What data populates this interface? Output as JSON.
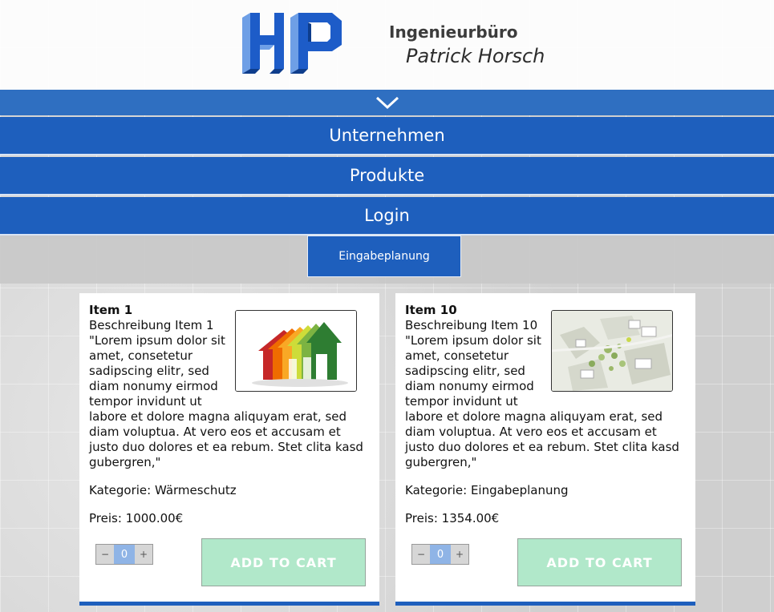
{
  "header": {
    "logo_text": "HP",
    "line1": "Ingenieurbüro",
    "line2": "Patrick Horsch"
  },
  "nav": {
    "toggle_icon": "chevron-down-icon",
    "items": [
      {
        "label": "Unternehmen"
      },
      {
        "label": "Produkte"
      },
      {
        "label": "Login"
      }
    ],
    "sub_tab": "Eingabeplanung"
  },
  "products": [
    {
      "title": "Item 1",
      "desc_label": "Beschreibung Item 1",
      "desc": "\"Lorem ipsum dolor sit amet, consetetur sadipscing elitr, sed diam nonumy eirmod tempor invidunt ut labore et dolore magna aliquyam erat, sed diam voluptua. At vero eos et accusam et justo duo dolores et ea rebum. Stet clita kasd gubergren,\"",
      "category": "Kategorie: Wärmeschutz",
      "price": "Preis: 1000.00€",
      "qty": "0",
      "qty_minus": "−",
      "qty_plus": "+",
      "add_label": "ADD TO CART",
      "image": "energy-efficiency-house-image"
    },
    {
      "title": "Item 10",
      "desc_label": "Beschreibung Item 10",
      "desc": "\"Lorem ipsum dolor sit amet, consetetur sadipscing elitr, sed diam nonumy eirmod tempor invidunt ut labore et dolore magna aliquyam erat, sed diam voluptua. At vero eos et accusam et justo duo dolores et ea rebum. Stet clita kasd gubergren,\"",
      "category": "Kategorie: Eingabeplanung",
      "price": "Preis: 1354.00€",
      "qty": "0",
      "qty_minus": "−",
      "qty_plus": "+",
      "add_label": "ADD TO CART",
      "image": "site-plan-image"
    }
  ],
  "colors": {
    "nav_blue": "#1e5fbd",
    "toggle_blue": "#2f6fc1",
    "add_button": "#b1e8ca",
    "qty_value": "#8fb4e6"
  }
}
